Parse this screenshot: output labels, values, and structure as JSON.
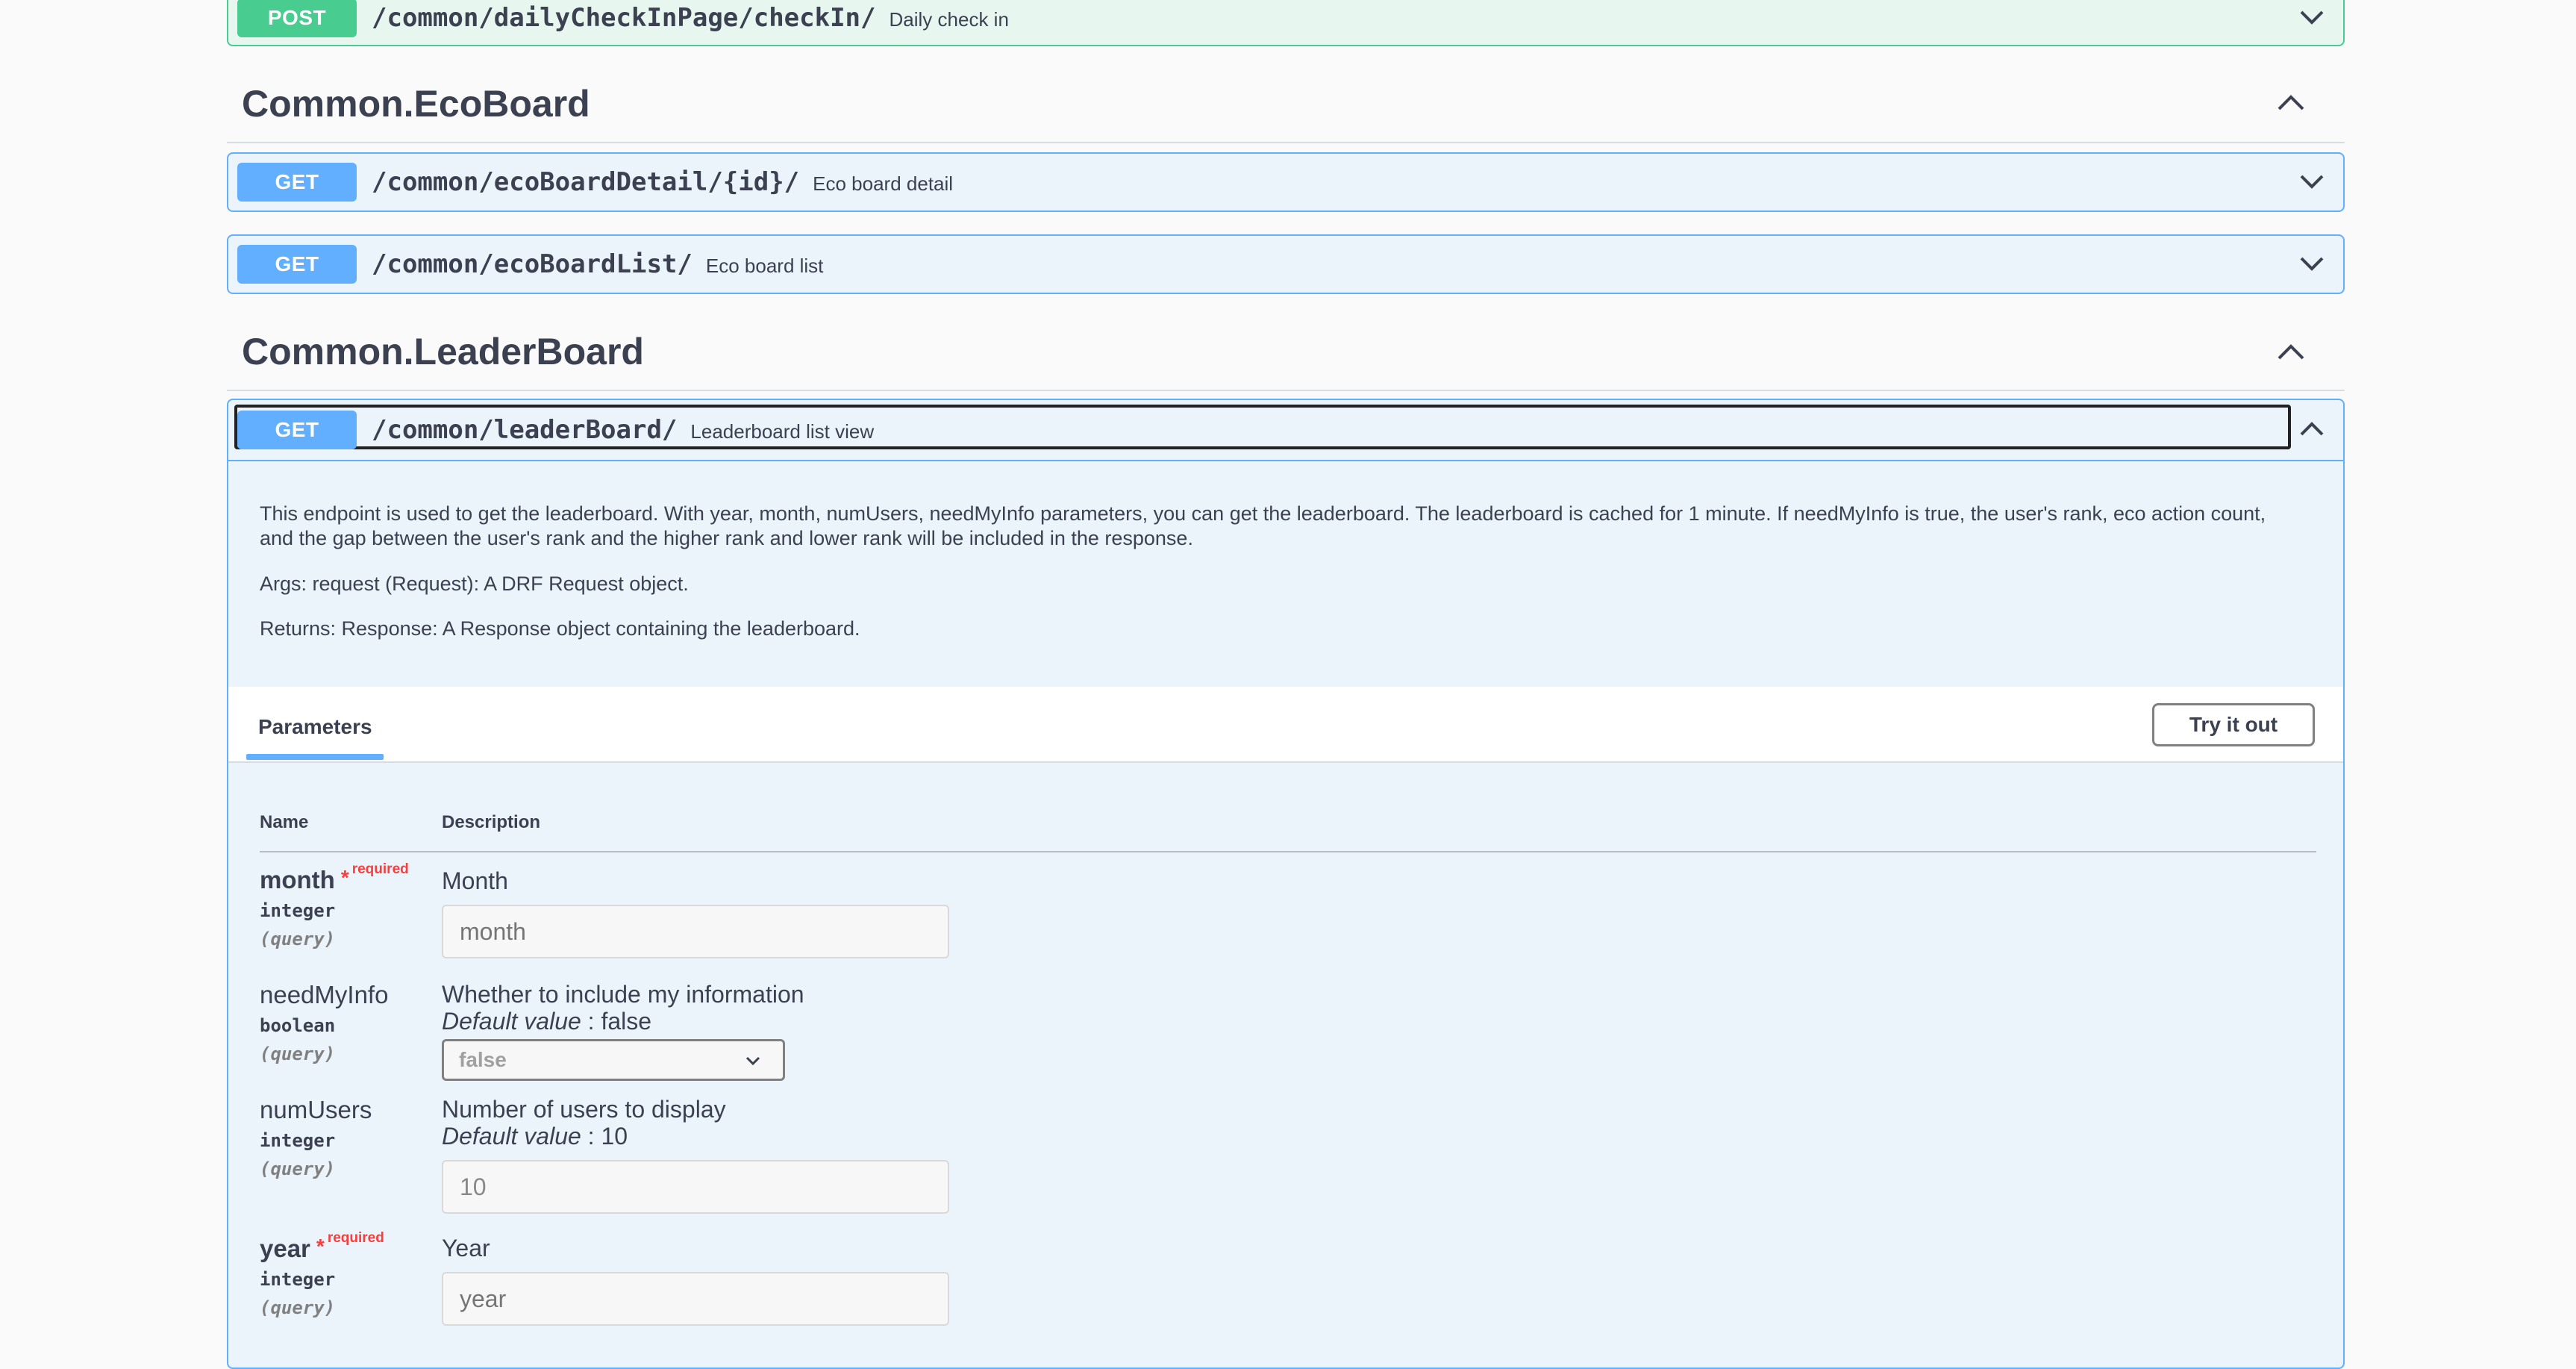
{
  "top_op": {
    "method": "POST",
    "path": "/common/dailyCheckInPage/checkIn/",
    "summary": "Daily check in"
  },
  "sections": [
    {
      "title": "Common.EcoBoard"
    },
    {
      "title": "Common.LeaderBoard"
    }
  ],
  "ecoboard_ops": [
    {
      "method": "GET",
      "path": "/common/ecoBoardDetail/{id}/",
      "summary": "Eco board detail"
    },
    {
      "method": "GET",
      "path": "/common/ecoBoardList/",
      "summary": "Eco board list"
    }
  ],
  "leaderboard_op": {
    "method": "GET",
    "path": "/common/leaderBoard/",
    "summary": "Leaderboard list view",
    "description": [
      "This endpoint is used to get the leaderboard. With year, month, numUsers, needMyInfo parameters, you can get the leaderboard. The leaderboard is cached for 1 minute. If needMyInfo is true, the user's rank, eco action count, and the gap between the user's rank and the higher rank and lower rank will be included in the response.",
      "Args: request (Request): A DRF Request object.",
      "Returns: Response: A Response object containing the leaderboard."
    ],
    "tab_label": "Parameters",
    "try_button": "Try it out",
    "col_name": "Name",
    "col_description": "Description",
    "required_label": "required",
    "required_star": "*",
    "default_label": "Default value",
    "params": [
      {
        "name": "month",
        "type": "integer",
        "in": "(query)",
        "description": "Month",
        "placeholder": "month"
      },
      {
        "name": "needMyInfo",
        "type": "boolean",
        "in": "(query)",
        "description": "Whether to include my information",
        "default": ": false",
        "selected": "false"
      },
      {
        "name": "numUsers",
        "type": "integer",
        "in": "(query)",
        "description": "Number of users to display",
        "default": ": 10",
        "value": "10"
      },
      {
        "name": "year",
        "type": "integer",
        "in": "(query)",
        "description": "Year",
        "placeholder": "year"
      }
    ]
  },
  "icons": {
    "collapse": "chevron-up-icon",
    "expand": "chevron-down-icon"
  },
  "colors": {
    "get": "#61affe",
    "post": "#49cc90",
    "required": "#f93e3e"
  }
}
